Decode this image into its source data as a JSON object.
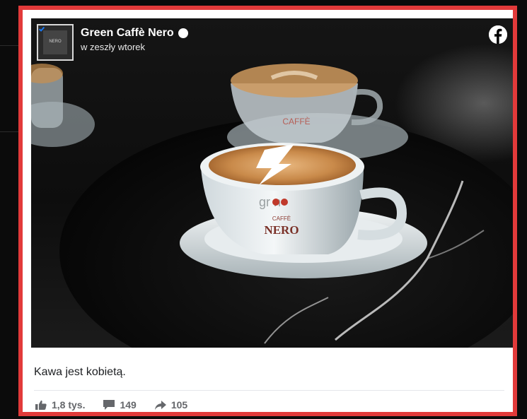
{
  "post": {
    "page_name": "Green Caffè Nero",
    "avatar_text": "NERO",
    "time": "w zeszły wtorek",
    "caption": "Kawa jest kobietą.",
    "stats": {
      "likes": "1,8 tys.",
      "comments": "149",
      "shares": "105"
    },
    "cup_brand_top": "gr  n",
    "cup_brand_caffe": "CAFFÈ",
    "cup_brand_nero": "NERO"
  },
  "icons": {
    "verified": "verified-badge-icon",
    "facebook": "facebook-logo-icon",
    "like": "thumbs-up-icon",
    "comment": "comment-icon",
    "share": "share-arrow-icon"
  },
  "colors": {
    "frame_border": "#e23a3a",
    "text_primary": "#1c1e21",
    "text_secondary": "#65676b",
    "background": "#0b0b0b"
  }
}
